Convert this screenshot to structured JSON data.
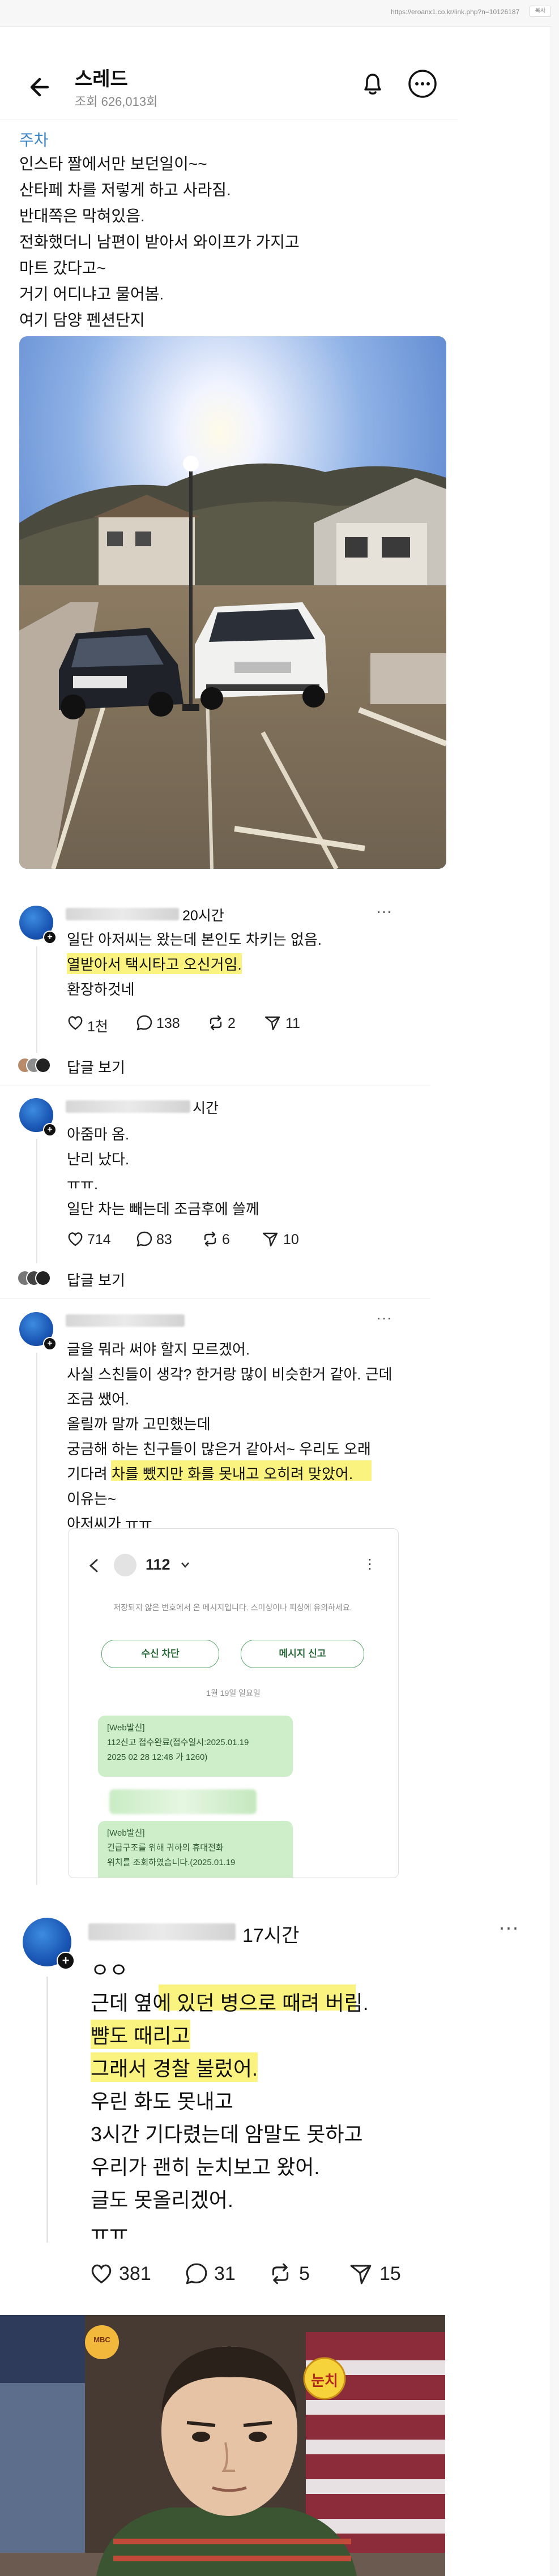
{
  "browser": {
    "url": "https://eroanx1.co.kr/link.php?n=10126187",
    "extension_label": "복사"
  },
  "header": {
    "title": "스레드",
    "views": "조회 626,013회"
  },
  "post": {
    "category": "주차",
    "lines": [
      "인스타 짤에서만 보던일이~~",
      "산타페 차를 저렇게 하고 사라짐.",
      "반대쪽은 막혀있음.",
      "전화했더니 남편이 받아서 와이프가 가지고",
      "마트 갔다고~",
      "거기 어디냐고 물어봄.",
      "여기 담양 펜션단지"
    ]
  },
  "comments": [
    {
      "time": "20시간",
      "lines": [
        "일단 아저씨는 왔는데 본인도 차키는 없음.",
        "열받아서 택시타고 오신거임.",
        "환장하것네"
      ],
      "likes": "1천",
      "replies": "138",
      "reposts": "2",
      "shares": "11",
      "reply_link": "답글 보기"
    },
    {
      "time": "시간",
      "lines": [
        "아줌마 옴.",
        "난리 났다.",
        "ㅠㅠ.",
        "일단 차는 빼는데 조금후에 쓸께"
      ],
      "likes": "714",
      "replies": "83",
      "reposts": "6",
      "shares": "10",
      "reply_link": "답글 보기"
    },
    {
      "lines": [
        "글을 뭐라 써야 할지 모르겠어.",
        "사실 스친들이 생각? 한거랑 많이 비슷한거 같아. 근데",
        "조금 쌨어.",
        "올릴까 말까 고민했는데",
        "궁금해 하는 친구들이 많은거 같아서~ 우리도 오래",
        "기다려 차를 뺐지만 화를 못내고 오히려 맞았어.",
        "이유는~",
        "아저씨가 ㅠㅠ"
      ]
    },
    {
      "time": "17시간",
      "lines": [
        "ㅇㅇ",
        "근데 옆에 있던 병으로 때려 버림.",
        "뺨도 때리고",
        "그래서 경찰 불렀어.",
        "우린 화도 못내고",
        "3시간 기다렸는데 암말도 못하고",
        "우리가 괜히 눈치보고 왔어.",
        "글도 못올리겠어.",
        "ㅠㅠ"
      ],
      "likes": "381",
      "replies": "31",
      "reposts": "5",
      "shares": "15"
    }
  ],
  "phone_screenshot": {
    "contact": "112",
    "notice": "저장되지 않은 번호에서 온 메시지입니다. 스미싱이나 피싱에 유의하세요.",
    "block_button": "수신 차단",
    "report_button": "메시지 신고",
    "date": "1월 19일 일요일",
    "msg1": [
      "[Web발신]",
      "112신고 접수완료(접수일시:2025.01.19",
      "2025 02 28 12:48 가 1260)"
    ],
    "msg2": [
      "[Web발신]",
      "긴급구조를 위해 귀하의 휴대전화",
      "위치를 조회하였습니다.(2025.01.19"
    ]
  },
  "meme": {
    "badge_text": "눈치",
    "logo_text": "MBC"
  }
}
